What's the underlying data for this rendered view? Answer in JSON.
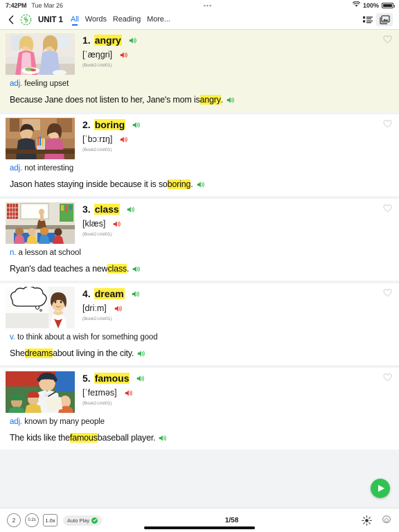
{
  "status_bar": {
    "time": "7:42PM",
    "date": "Tue Mar 26",
    "center_dots": "•••",
    "battery_percent": "100%",
    "wifi_icon": "wifi-icon",
    "battery_icon": "battery-icon"
  },
  "nav": {
    "back_icon": "back-chevron-icon",
    "logo_icon": "app-logo-icon",
    "unit_title": "UNIT 1",
    "tabs": [
      {
        "label": "All",
        "active": true
      },
      {
        "label": "Words",
        "active": false
      },
      {
        "label": "Reading",
        "active": false
      },
      {
        "label": "More...",
        "active": false
      }
    ],
    "list_view_icon": "list-view-icon",
    "card_view_icon": "image-view-icon"
  },
  "entries": [
    {
      "number": "1.",
      "word": "angry",
      "phonetic": "[ˈæŋgri]",
      "source": "(Book2-Unit01)",
      "pos": "adj.",
      "meaning": "feeling upset",
      "example_pre": "Because Jane does not listen to her, Jane's mom is ",
      "example_hl": "angry",
      "example_post": ".",
      "active": true,
      "word_speaker_icon": "speaker-green-icon",
      "phonetic_speaker_icon": "speaker-red-icon",
      "example_speaker_icon": "speaker-green-icon",
      "favorite_icon": "heart-outline-icon"
    },
    {
      "number": "2.",
      "word": "boring",
      "phonetic": "[ˈbɔːrɪŋ]",
      "source": "(Book2-Unit01)",
      "pos": "adj.",
      "meaning": "not interesting",
      "example_pre": "Jason hates staying inside because it is so ",
      "example_hl": "boring",
      "example_post": ".",
      "active": false,
      "word_speaker_icon": "speaker-green-icon",
      "phonetic_speaker_icon": "speaker-red-icon",
      "example_speaker_icon": "speaker-green-icon",
      "favorite_icon": "heart-outline-icon"
    },
    {
      "number": "3.",
      "word": "class",
      "phonetic": "[klæs]",
      "source": "(Book2-Unit01)",
      "pos": "n.",
      "meaning": "a lesson at school",
      "example_pre": "Ryan's dad teaches a new ",
      "example_hl": "class",
      "example_post": ".",
      "active": false,
      "word_speaker_icon": "speaker-green-icon",
      "phonetic_speaker_icon": "speaker-red-icon",
      "example_speaker_icon": "speaker-green-icon",
      "favorite_icon": "heart-outline-icon"
    },
    {
      "number": "4.",
      "word": "dream",
      "phonetic": "[driːm]",
      "source": "(Book2-Unit01)",
      "pos": "v.",
      "meaning": "to think about a wish for something good",
      "example_pre": "She ",
      "example_hl": "dreams",
      "example_post": " about living in the city.",
      "active": false,
      "word_speaker_icon": "speaker-green-icon",
      "phonetic_speaker_icon": "speaker-red-icon",
      "example_speaker_icon": "speaker-green-icon",
      "favorite_icon": "heart-outline-icon"
    },
    {
      "number": "5.",
      "word": "famous",
      "phonetic": "[ˈfeɪməs]",
      "source": "(Book2-Unit01)",
      "pos": "adj.",
      "meaning": "known by many people",
      "example_pre": "The kids like the ",
      "example_hl": "famous",
      "example_post": " baseball player.",
      "active": false,
      "word_speaker_icon": "speaker-green-icon",
      "phonetic_speaker_icon": "speaker-red-icon",
      "example_speaker_icon": "speaker-green-icon",
      "favorite_icon": "heart-outline-icon"
    }
  ],
  "play_button": {
    "icon": "play-icon",
    "color": "#31c352"
  },
  "bottom_bar": {
    "repeat_count": "2",
    "delay": "0.2s",
    "speed": "1.0x",
    "auto_play_label": "Auto Play",
    "auto_play_checked": true,
    "page_indicator": "1/58",
    "brightness_icon": "brightness-icon",
    "settings_icon": "gear-icon"
  },
  "colors": {
    "highlight": "#ffef3f",
    "accent_blue": "#1a73e8",
    "green": "#31c352",
    "red": "#e8352c",
    "active_card_bg": "#f6f6e4"
  }
}
